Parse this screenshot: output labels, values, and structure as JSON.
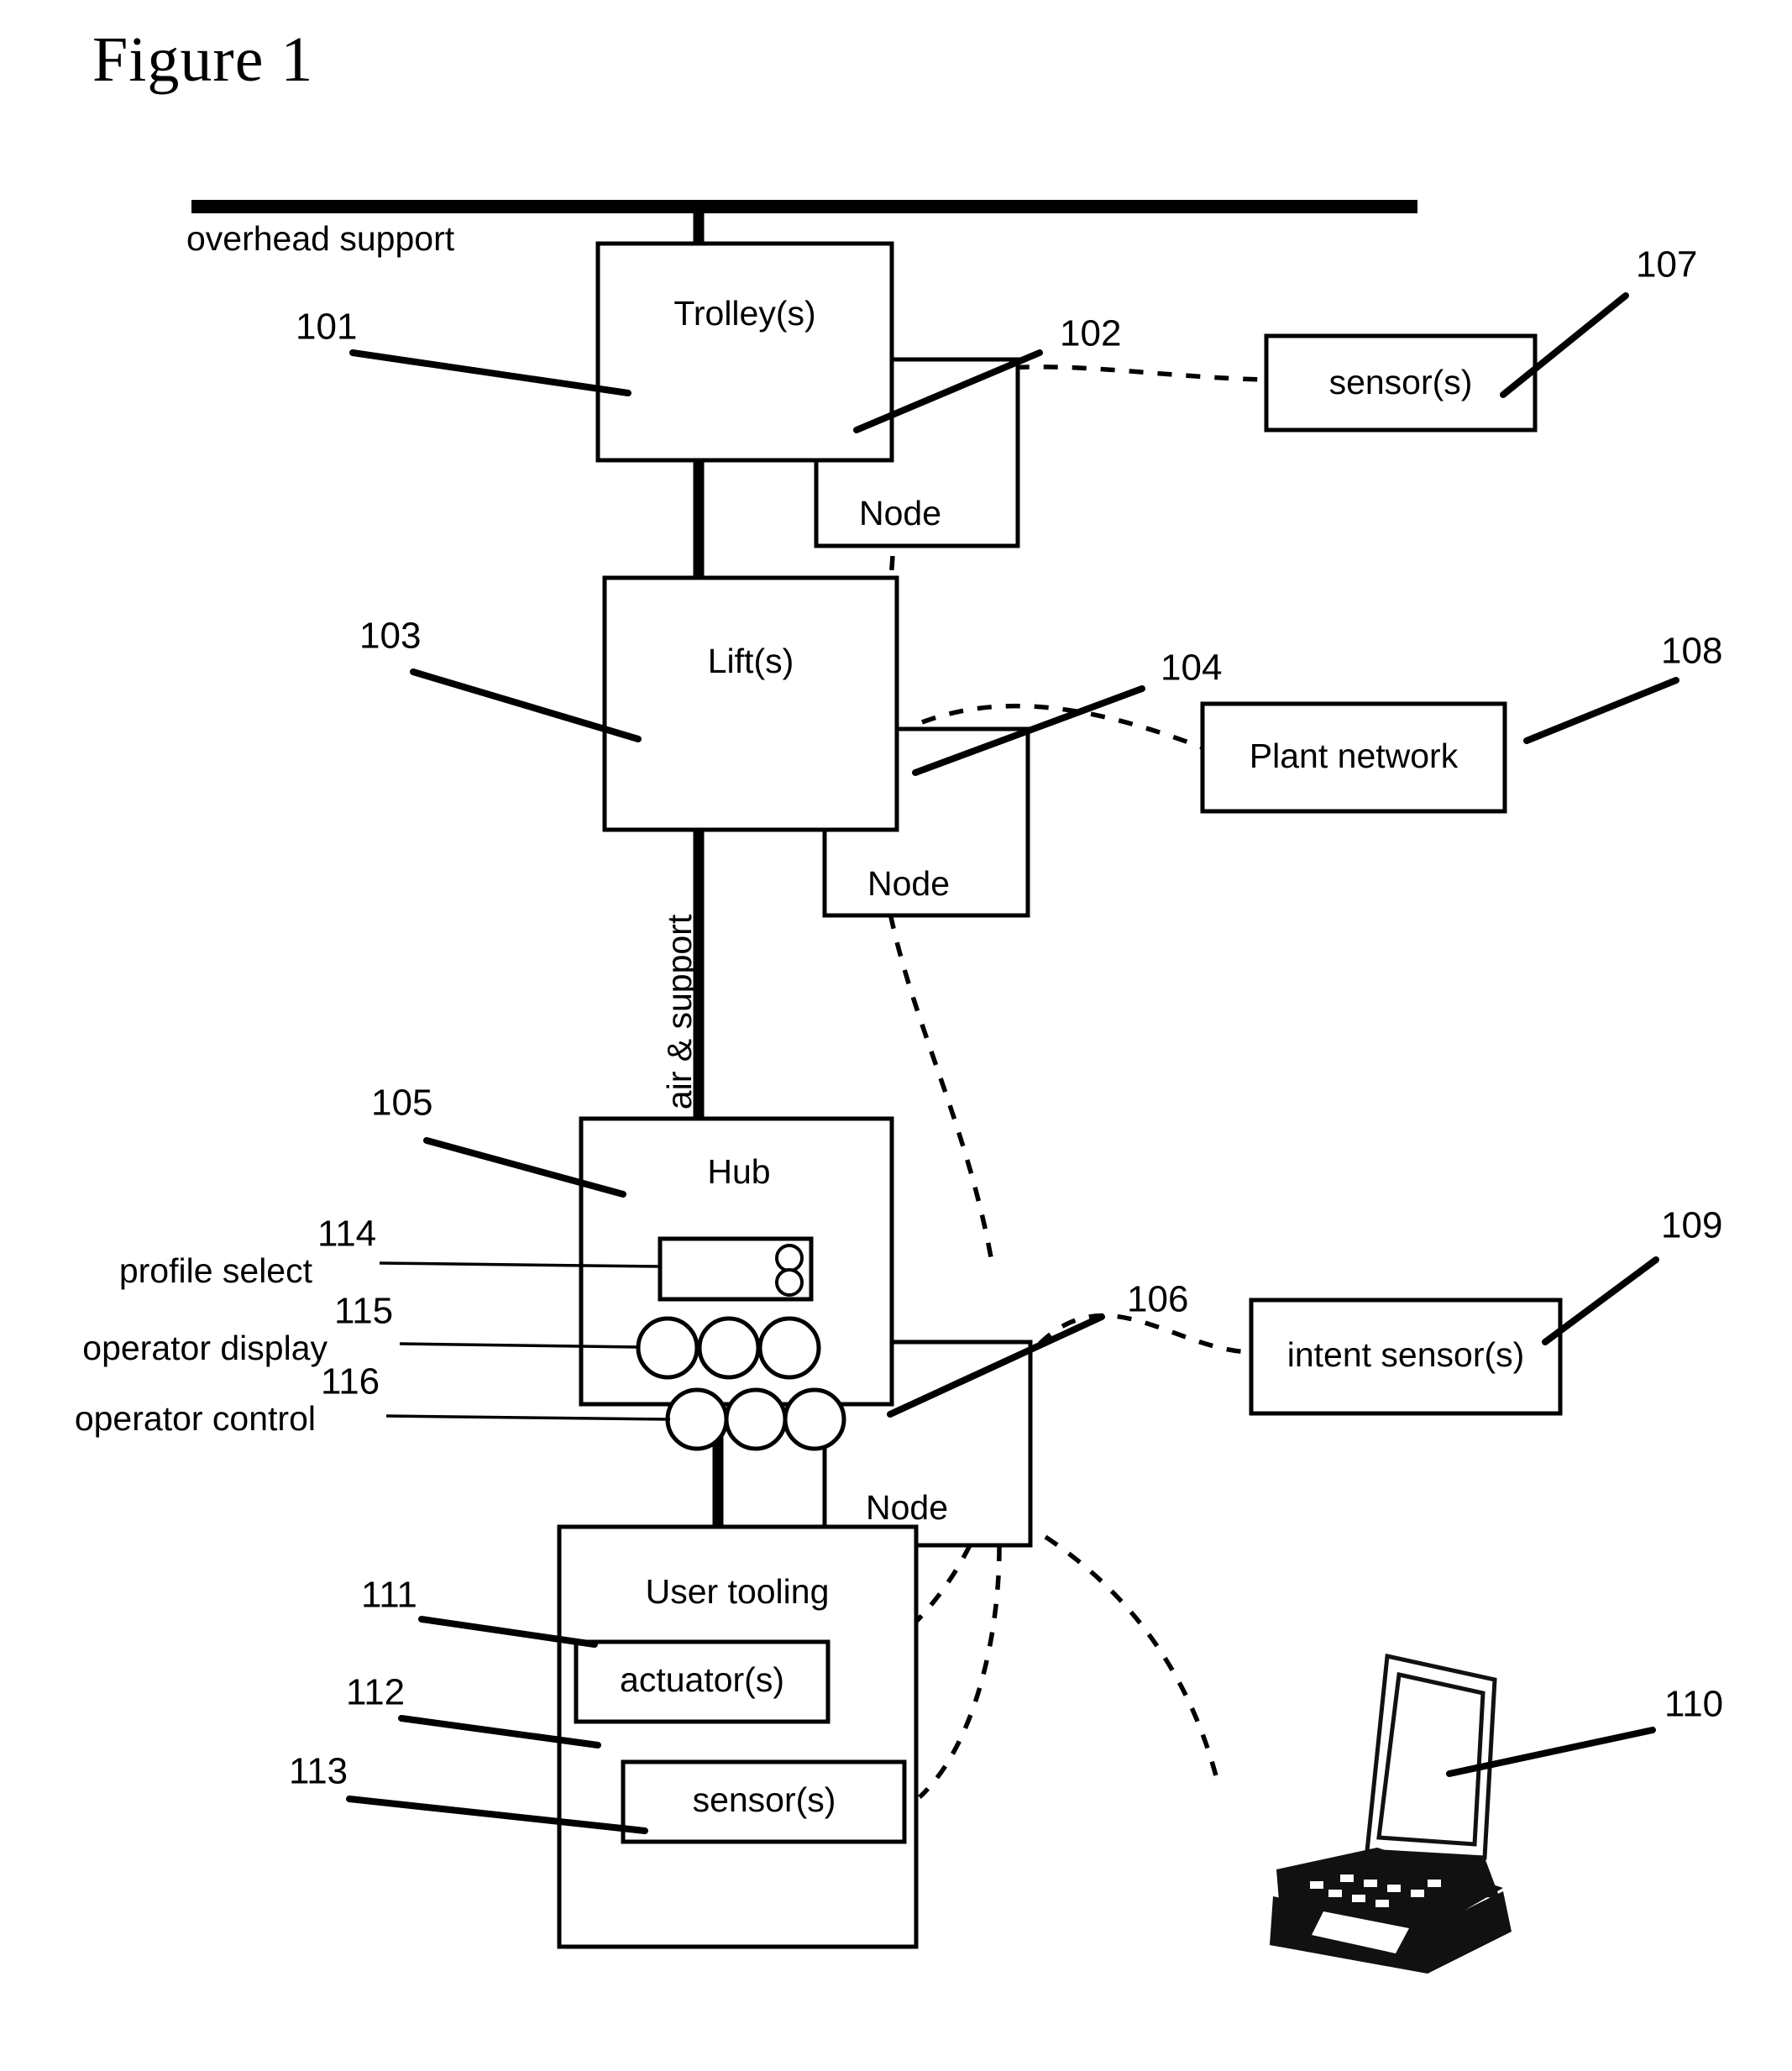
{
  "figure": {
    "title": "Figure 1"
  },
  "labels": {
    "overhead_support": "overhead support",
    "air_support": "air & support",
    "profile_select": "profile select",
    "operator_display": "operator display",
    "operator_control": "operator control"
  },
  "blocks": {
    "trolley": "Trolley(s)",
    "node_102": "Node",
    "lift": "Lift(s)",
    "node_104": "Node",
    "hub": "Hub",
    "node_106": "Node",
    "sensor_107": "sensor(s)",
    "plant_network": "Plant network",
    "intent_sensor": "intent sensor(s)",
    "user_tooling": "User tooling",
    "actuator": "actuator(s)",
    "sensor_113": "sensor(s)"
  },
  "reference_numbers": {
    "n101": "101",
    "n102": "102",
    "n103": "103",
    "n104": "104",
    "n105": "105",
    "n106": "106",
    "n107": "107",
    "n108": "108",
    "n109": "109",
    "n110": "110",
    "n111": "111",
    "n112": "112",
    "n113": "113",
    "n114": "114",
    "n115": "115",
    "n116": "116"
  },
  "icons": {
    "laptop": "laptop-computer-icon"
  },
  "colors": {
    "ink": "#000000",
    "paper": "#ffffff"
  }
}
